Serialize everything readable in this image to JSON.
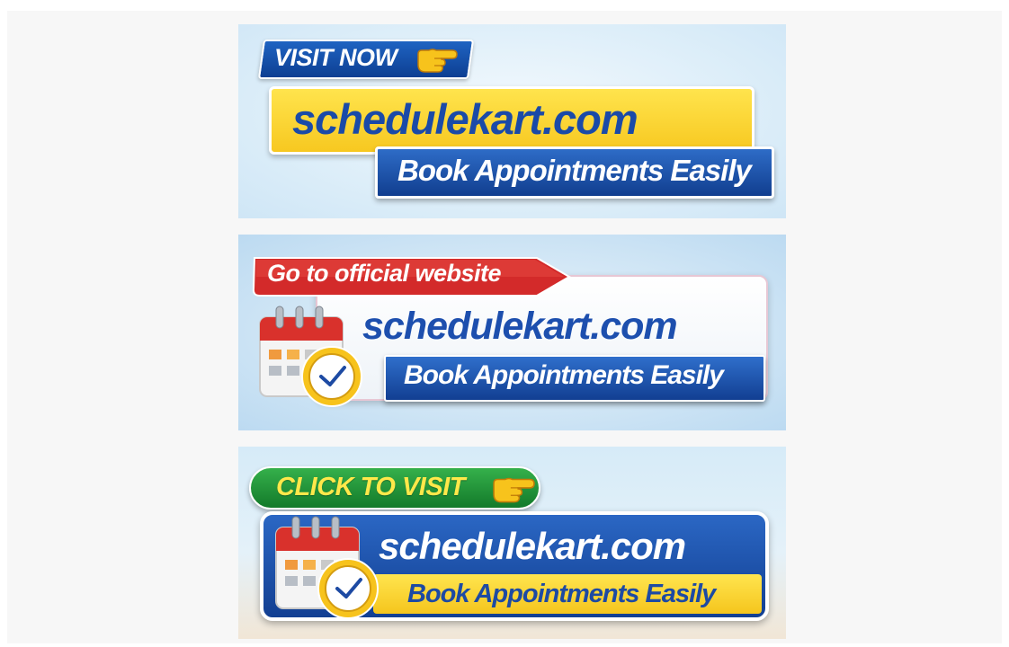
{
  "banners": [
    {
      "cta": "VISIT NOW",
      "domain": "schedulekart.com",
      "tagline": "Book Appointments Easily",
      "icons": [
        "pointing-hand-icon"
      ],
      "colors": {
        "cta_bg": "#1a52ad",
        "domain_bg": "#fcd835",
        "domain_text": "#1a4aa8",
        "tagline_bg": "#1a4fa3"
      }
    },
    {
      "cta": "Go to official website",
      "domain": "schedulekart.com",
      "tagline": "Book Appointments Easily",
      "icons": [
        "calendar-clock-icon"
      ],
      "colors": {
        "cta_bg": "#d32a2a",
        "card_bg": "#ffffff",
        "domain_text": "#1d4fae",
        "tagline_bg": "#1c50a6"
      }
    },
    {
      "cta": "CLICK TO VISIT",
      "domain": "schedulekart.com",
      "tagline": "Book Appointments Easily",
      "icons": [
        "pointing-hand-icon",
        "calendar-clock-icon"
      ],
      "colors": {
        "cta_bg": "#22963a",
        "cta_text": "#ffe84a",
        "domain_bg": "#1d55b3",
        "tagline_bg": "#fcd835",
        "tagline_text": "#1d4aa3"
      }
    }
  ]
}
